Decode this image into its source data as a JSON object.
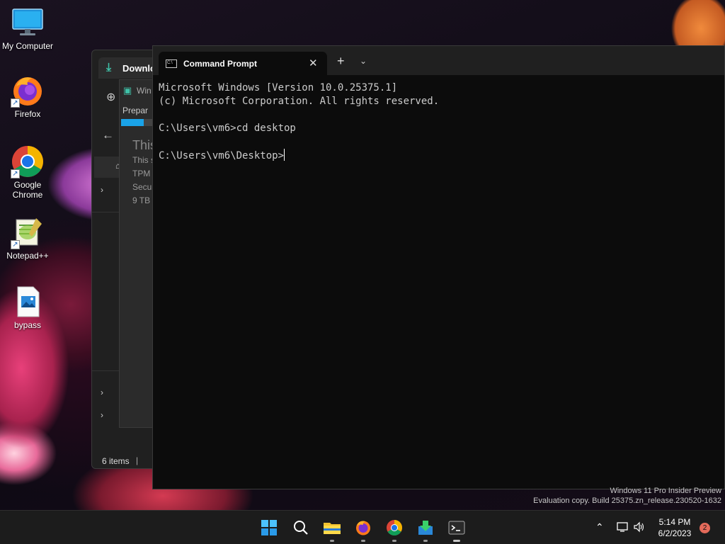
{
  "desktop": {
    "icons": [
      {
        "label": "My Computer"
      },
      {
        "label": "Firefox"
      },
      {
        "label": "Google Chrome"
      },
      {
        "label": "Notepad++"
      },
      {
        "label": "bypass"
      }
    ]
  },
  "explorer": {
    "tab_label": "Downlo",
    "status_items": "6 items",
    "dialog": {
      "title": "Win",
      "progress_label": "Prepar",
      "progress": 0.55,
      "heading": "This",
      "lines": [
        "This s",
        "TPM",
        "Secu",
        "9 TB"
      ]
    }
  },
  "terminal": {
    "tab_title": "Command Prompt",
    "lines": [
      "Microsoft Windows [Version 10.0.25375.1]",
      "(c) Microsoft Corporation. All rights reserved.",
      "",
      "C:\\Users\\vm6>cd desktop",
      "",
      "C:\\Users\\vm6\\Desktop>"
    ]
  },
  "watermark": {
    "line1": "Windows 11 Pro Insider Preview",
    "line2": "Evaluation copy. Build 25375.zn_release.230520-1632"
  },
  "taskbar": {
    "time": "5:14 PM",
    "date": "6/2/2023",
    "notification_count": "2"
  },
  "colors": {
    "accent": "#1aa3e8",
    "terminal_bg": "#0c0c0c",
    "taskbar_bg": "#1c1c1c",
    "notification_badge": "#e46a5a"
  }
}
